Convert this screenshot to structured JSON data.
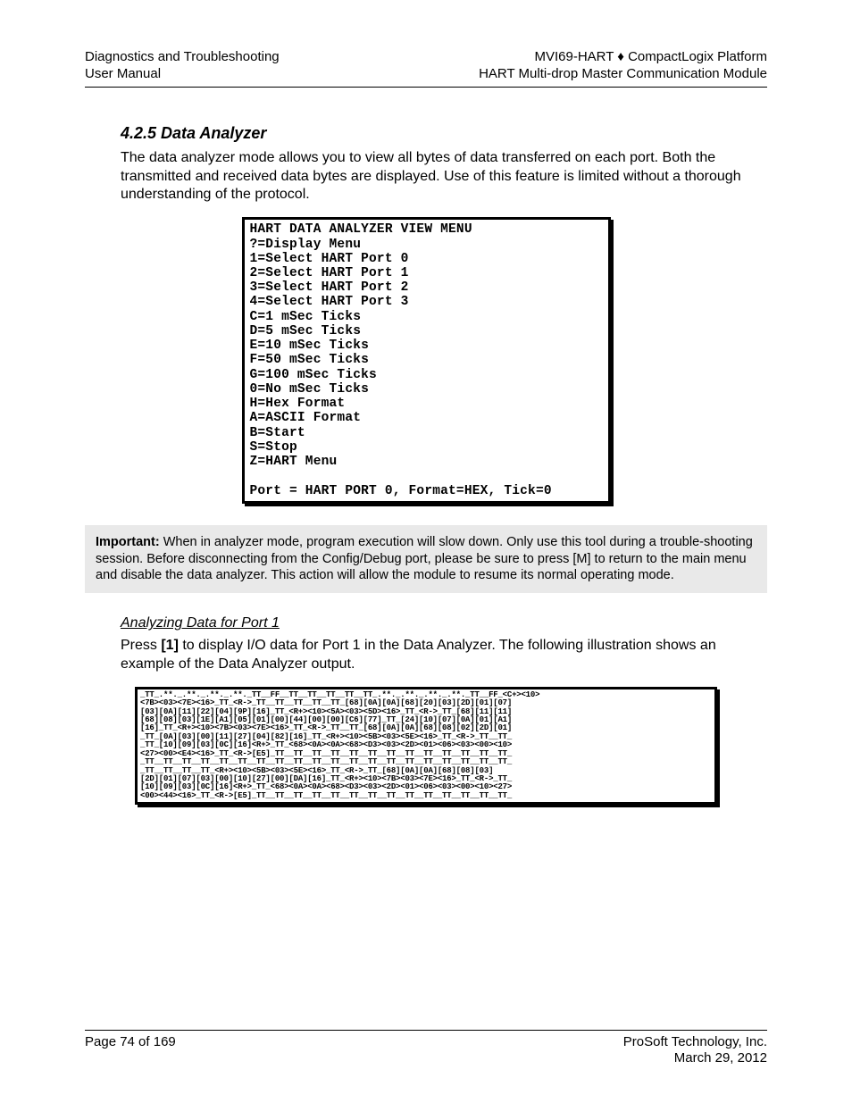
{
  "header": {
    "left_line1": "Diagnostics and Troubleshooting",
    "left_line2": "User Manual",
    "right_line1": "MVI69-HART ♦ CompactLogix Platform",
    "right_line2": "HART Multi-drop Master Communication Module"
  },
  "section": {
    "number_title": "4.2.5   Data Analyzer",
    "intro": "The data analyzer mode allows you to view all bytes of data transferred on each port. Both the transmitted and received data bytes are displayed. Use of this feature is limited without a thorough understanding of the protocol."
  },
  "terminal": {
    "lines": [
      "HART DATA ANALYZER VIEW MENU",
      "?=Display Menu",
      "1=Select HART Port 0",
      "2=Select HART Port 1",
      "3=Select HART Port 2",
      "4=Select HART Port 3",
      "C=1 mSec Ticks",
      "D=5 mSec Ticks",
      "E=10 mSec Ticks",
      "F=50 mSec Ticks",
      "G=100 mSec Ticks",
      "0=No mSec Ticks",
      "H=Hex Format",
      "A=ASCII Format",
      "B=Start",
      "S=Stop",
      "Z=HART Menu",
      "",
      "Port = HART PORT 0, Format=HEX, Tick=0"
    ]
  },
  "note": {
    "label": "Important:",
    "text": " When in analyzer mode, program execution will slow down. Only use this tool during a trouble-shooting session. Before disconnecting from the Config/Debug port, please be sure to press [M] to return to the main menu and disable the data analyzer. This action will allow the module to resume its normal operating mode."
  },
  "sub": {
    "heading": "Analyzing Data for Port 1",
    "p1a": "Press ",
    "p1b": "[1]",
    "p1c": " to display I/O data for Port 1 in the Data Analyzer. The following illustration shows an example of the Data Analyzer output."
  },
  "data_dump": {
    "lines": [
      "_TT_.**._.**._.**._.**._TT__FF__TT__TT__TT__TT__TT_.**._.**._.**._.**._TT__FF_<C+><10>",
      "<7B><03><7E><16>_TT_<R->_TT__TT__TT__TT__TT_[68][0A][0A][68][20][03][2D][01][07]",
      "[03][0A][11][22][04][9P][16]_TT_<R+><10><5A><03><5D><16>_TT_<R->_TT_[68][11][11]",
      "[68][08][03][1E][A1][05][01][00][44][00][00][C6][77]_TT_[24][10][07][0A][01][A1]",
      "[16]_TT_<R+><10><7B><03><7E><16>_TT_<R->_TT__TT_[68][0A][0A][68][08][02][2D][01]",
      "_TT_[0A][03][00][11][27][04][82][16]_TT_<R+><10><5B><03><5E><16>_TT_<R->_TT__TT_",
      "_TT_[10][09][03][0C][16]<R+>_TT_<68><0A><0A><68><D3><03><2D><01><06><03><00><10>",
      "<27><00><E4><16>_TT_<R->[E5]_TT__TT__TT__TT__TT__TT__TT__TT__TT__TT__TT__TT__TT_",
      "_TT__TT__TT__TT__TT__TT__TT__TT__TT__TT__TT__TT__TT__TT__TT__TT__TT__TT__TT__TT_",
      "_TT__TT__TT__TT_<R+><10><5B><03><5E><16>_TT_<R->_TT_[68][0A][0A][68][08][03]",
      "[2D][01][07][03][00][10][27][00][DA][16]_TT_<R+><10><7B><03><7E><16>_TT_<R->_TT_",
      "[10][09][03][0C][16]<R+>_TT_<68><0A><0A><68><D3><03><2D><01><06><03><00><10><27>",
      "<00><44><16>_TT_<R->[E5]_TT__TT__TT__TT__TT__TT__TT__TT__TT__TT__TT__TT__TT__TT_"
    ]
  },
  "footer": {
    "left": "Page 74 of 169",
    "right_line1": "ProSoft Technology, Inc.",
    "right_line2": "March 29, 2012"
  }
}
